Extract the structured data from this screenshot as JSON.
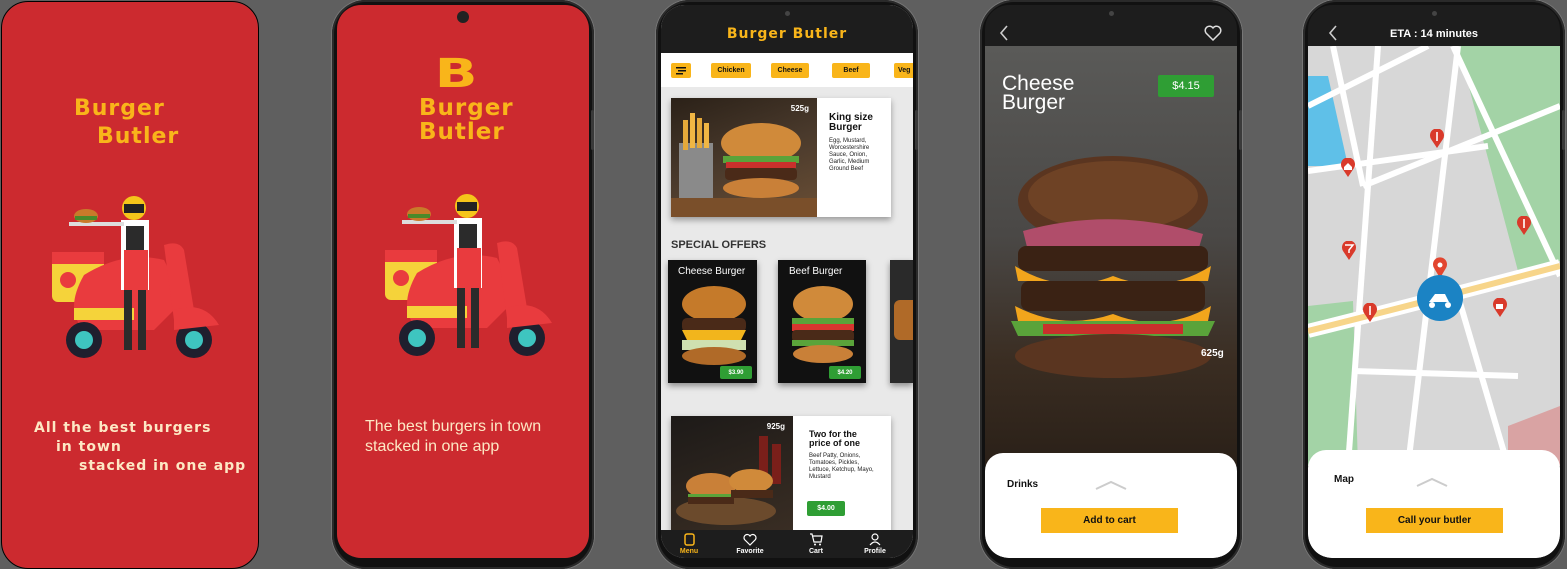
{
  "splash1": {
    "logo_line1": "Burger",
    "logo_line2": "Butler",
    "tagline_line1": "All the best burgers",
    "tagline_line2": "in town",
    "tagline_line3": "stacked in one app"
  },
  "splash2": {
    "logo_mark": "B",
    "logo_line1": "Burger",
    "logo_line2": "Butler",
    "tagline_line1": "The best burgers in town",
    "tagline_line2": "stacked in one app"
  },
  "menu": {
    "title": "Burger Butler",
    "categories": [
      "Chicken",
      "Cheese",
      "Beef",
      "Veg"
    ],
    "featured": {
      "weight": "525g",
      "name": "King size Burger",
      "ingredients": "Egg, Mustard, Worcestershire Sauce, Onion, Garlic, Medium Ground Beef"
    },
    "special_heading": "SPECIAL OFFERS",
    "offers": [
      {
        "name": "Cheese Burger",
        "price": "$3.90"
      },
      {
        "name": "Beef Burger",
        "price": "$4.20"
      }
    ],
    "deal": {
      "weight": "925g",
      "name": "Two for the price of one",
      "ingredients": "Beef Patty, Onions, Tomatoes, Pickles, Lettuce, Ketchup, Mayo, Mustard",
      "price": "$4.00"
    },
    "nav": [
      "Menu",
      "Favorite",
      "Cart",
      "Profile"
    ]
  },
  "detail": {
    "name_line1": "Cheese",
    "name_line2": "Burger",
    "price": "$4.15",
    "weight": "625g",
    "sheet_label": "Drinks",
    "add_button": "Add to cart"
  },
  "tracking": {
    "eta": "ETA : 14 minutes",
    "sheet_label": "Map",
    "call_button": "Call your butler"
  },
  "colors": {
    "brand_red": "#cc2a2f",
    "brand_yellow": "#f9b51a",
    "price_green": "#2f9e34",
    "map_blue": "#1b83c4"
  }
}
